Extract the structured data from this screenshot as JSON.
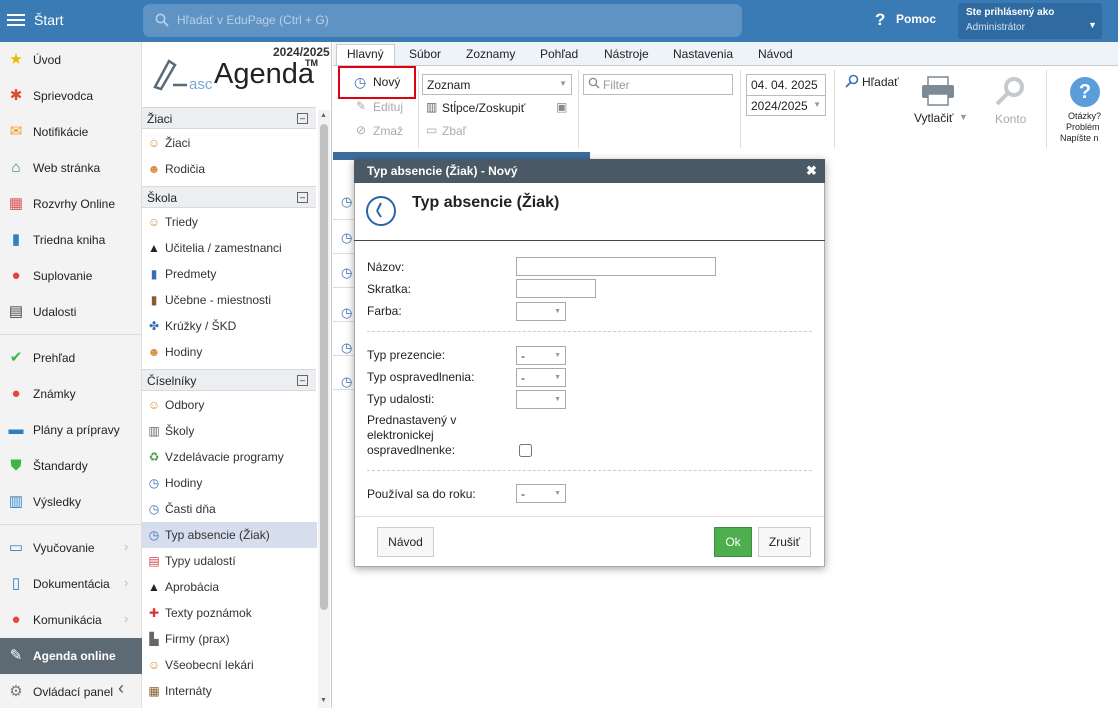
{
  "topbar": {
    "start_label": "Štart",
    "search_placeholder": "Hľadať v EduPage (Ctrl + G)",
    "help_label": "Pomoc",
    "user_line1": "Ste prihlásený ako",
    "user_line2": "Administrátor"
  },
  "leftnav": {
    "items": [
      {
        "label": "Úvod",
        "icon": "star-icon"
      },
      {
        "label": "Sprievodca",
        "icon": "wizard-icon"
      },
      {
        "label": "Notifikácie",
        "icon": "envelope-icon"
      },
      {
        "label": "Web stránka",
        "icon": "home-icon"
      },
      {
        "label": "Rozvrhy Online",
        "icon": "timetable-icon"
      },
      {
        "label": "Triedna kniha",
        "icon": "book-icon"
      },
      {
        "label": "Suplovanie",
        "icon": "substitution-icon"
      },
      {
        "label": "Udalosti",
        "icon": "calendar-icon"
      },
      {
        "label": "Prehľad",
        "icon": "check-circle-icon"
      },
      {
        "label": "Známky",
        "icon": "grades-icon"
      },
      {
        "label": "Plány a prípravy",
        "icon": "briefcase-icon"
      },
      {
        "label": "Štandardy",
        "icon": "shield-icon"
      },
      {
        "label": "Výsledky",
        "icon": "bar-chart-icon"
      },
      {
        "label": "Vyučovanie",
        "icon": "open-book-icon"
      },
      {
        "label": "Dokumentácia",
        "icon": "document-icon"
      },
      {
        "label": "Komunikácia",
        "icon": "chat-icon"
      },
      {
        "label": "Agenda online",
        "icon": "pen-icon"
      },
      {
        "label": "Ovládací panel",
        "icon": "gear-icon"
      }
    ]
  },
  "tree": {
    "year": "2024/2025",
    "logo_asc": "asc",
    "logo_agenda": "Agenda",
    "logo_tm": "TM",
    "groups": {
      "ziaci": "Žiaci",
      "skola": "Škola",
      "ciselniky": "Číselníky"
    },
    "ziaci_items": [
      "Žiaci",
      "Rodičia"
    ],
    "skola_items": [
      "Triedy",
      "Učitelia / zamestnanci",
      "Predmety",
      "Učebne - miestnosti",
      "Krúžky / ŠKD",
      "Hodiny"
    ],
    "ciselniky_items": [
      "Odbory",
      "Školy",
      "Vzdelávacie programy",
      "Hodiny",
      "Časti dňa",
      "Typ absencie (Žiak)",
      "Typy udalostí",
      "Aprobácia",
      "Texty poznámok",
      "Firmy (prax)",
      "Všeobecní lekári",
      "Internáty"
    ]
  },
  "ribbon": {
    "tabs": [
      "Hlavný",
      "Súbor",
      "Zoznamy",
      "Pohľad",
      "Nástroje",
      "Nastavenia",
      "Návod"
    ],
    "novy": "Nový",
    "edituj": "Edituj",
    "zmaz": "Zmaž",
    "view_select": "Zoznam",
    "stlpce": "Stĺpce/Zoskupiť",
    "zbal": "Zbaľ",
    "filter_placeholder": "Filter",
    "date": "04. 04. 2025",
    "year_select": "2024/2025",
    "hladat": "Hľadať",
    "vytlacit": "Vytlačiť",
    "konto": "Konto",
    "help_l1": "Otázky?",
    "help_l2": "Problém",
    "help_l3": "Napíšte n"
  },
  "dialog": {
    "title": "Typ absencie (Žiak) - Nový",
    "heading": "Typ absencie (Žiak)",
    "nazov_label": "Názov:",
    "nazov_value": "",
    "skratka_label": "Skratka:",
    "skratka_value": "",
    "farba_label": "Farba:",
    "farba_value": "",
    "typ_prezencie_label": "Typ prezencie:",
    "typ_prezencie_value": "-",
    "typ_ospravedlnenia_label": "Typ ospravedlnenia:",
    "typ_ospravedlnenia_value": "-",
    "typ_udalosti_label": "Typ udalosti:",
    "typ_udalosti_value": "",
    "prednastaveny_l1": "Prednastavený v",
    "prednastaveny_l2": "elektronickej",
    "prednastaveny_l3": "ospravedlnenke:",
    "prednastaveny_checked": false,
    "pouzival_label": "Používal sa do roku:",
    "pouzival_value": "-",
    "navod_button": "Návod",
    "ok_button": "Ok",
    "zrusit_button": "Zrušiť"
  }
}
